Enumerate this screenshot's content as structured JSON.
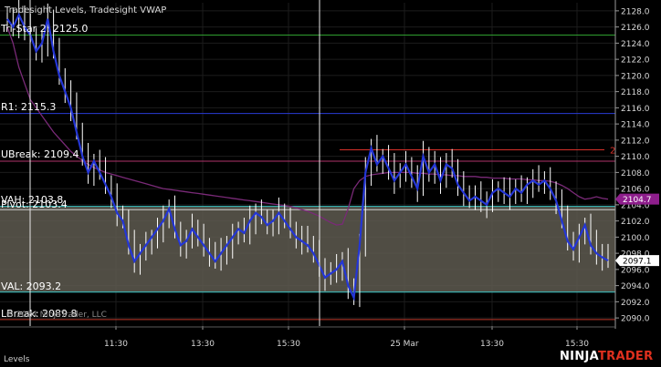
{
  "chart_data": {
    "type": "candlestick",
    "title": "Tradesight Levels, Tradesight VWAP",
    "panel_label": "Levels",
    "copyright": "© 2024 NinjaTrader, LLC",
    "ylim": [
      2089.0,
      2129.0
    ],
    "y_ticks": [
      2090.0,
      2092.0,
      2094.0,
      2096.0,
      2098.0,
      2100.0,
      2102.0,
      2104.0,
      2106.0,
      2108.0,
      2110.0,
      2112.0,
      2114.0,
      2116.0,
      2118.0,
      2120.0,
      2122.0,
      2124.0,
      2126.0,
      2128.0
    ],
    "y_tick_labels": [
      "2090.0",
      "2092.0",
      "2094.0",
      "2096.0",
      "2098.0",
      "2100.0",
      "2102.0",
      "2104.0",
      "2106.0",
      "2108.0",
      "2110.0",
      "2112.0",
      "2114.0",
      "2116.0",
      "2118.0",
      "2120.0",
      "2122.0",
      "2124.0",
      "2126.0",
      "2128.0"
    ],
    "x_tick_labels": [
      "11:30",
      "13:30",
      "15:30",
      "25 Mar",
      "13:30",
      "15:30"
    ],
    "grid": true,
    "value_area": {
      "low": 2093.2,
      "high": 2103.8,
      "color": "#5e5a50"
    },
    "levels": [
      {
        "label": "Tri-Star 2: 2125.0",
        "value": 2125.0,
        "color": "#2f9e2f"
      },
      {
        "label": "R1: 2115.3",
        "value": 2115.3,
        "color": "#2a3bd6"
      },
      {
        "label": "UBreak: 2109.4",
        "value": 2109.4,
        "color": "#b0336a"
      },
      {
        "label": "VAH: 2103.8",
        "value": 2103.8,
        "color": "#39c6c6"
      },
      {
        "label": "Pivot: 2103.4",
        "value": 2103.4,
        "color": "#cfcfcf"
      },
      {
        "label": "VAL: 2093.2",
        "value": 2093.2,
        "color": "#39c6c6"
      },
      {
        "label": "LBreak: 2089.8",
        "value": 2089.8,
        "color": "#c0392b"
      }
    ],
    "short_level": {
      "label": "2",
      "value": 2110.8,
      "color": "#d6312a"
    },
    "markers": [
      {
        "label": "2104.7",
        "value": 2104.7,
        "color": "#8e1e8c"
      },
      {
        "label": "2097.1",
        "value": 2097.1,
        "color": "#ffffff"
      }
    ],
    "vwap_color": "#7a2a78",
    "vwap": [
      2126,
      2124,
      2121,
      2119,
      2117,
      2116,
      2115,
      2114,
      2113,
      2112.2,
      2111.4,
      2110.6,
      2110.0,
      2109.5,
      2109.0,
      2108.6,
      2108.3,
      2108.0,
      2107.8,
      2107.6,
      2107.4,
      2107.2,
      2107.0,
      2106.8,
      2106.6,
      2106.4,
      2106.2,
      2106.0,
      2105.9,
      2105.8,
      2105.7,
      2105.6,
      2105.5,
      2105.4,
      2105.3,
      2105.2,
      2105.1,
      2105.0,
      2104.9,
      2104.8,
      2104.7,
      2104.6,
      2104.5,
      2104.4,
      2104.3,
      2104.2,
      2104.1,
      2104.0,
      2103.9,
      2103.8,
      2103.6,
      2103.4,
      2103.2,
      2102.9,
      2102.6,
      2102.2,
      2101.8,
      2101.5,
      2101.6,
      2103.5,
      2106.0,
      2107.0,
      2107.5,
      2107.7,
      2107.8,
      2107.9,
      2108.0,
      2108.0,
      2108.0,
      2108.0,
      2108.0,
      2107.9,
      2107.9,
      2107.8,
      2107.8,
      2107.7,
      2107.7,
      2107.6,
      2107.6,
      2107.5,
      2107.5,
      2107.5,
      2107.4,
      2107.4,
      2107.3,
      2107.3,
      2107.3,
      2107.2,
      2107.2,
      2107.2,
      2107.1,
      2107.1,
      2107.0,
      2107.0,
      2106.9,
      2106.7,
      2106.4,
      2106.0,
      2105.5,
      2105.0,
      2104.7,
      2104.8,
      2105.0,
      2104.8,
      2104.7
    ],
    "closes": [
      2127,
      2126,
      2127.5,
      2126,
      2125,
      2123,
      2124,
      2127,
      2123,
      2120,
      2118,
      2116,
      2113,
      2110,
      2108,
      2109.4,
      2108,
      2106.5,
      2105,
      2103,
      2102,
      2099,
      2097,
      2098,
      2099,
      2100,
      2101,
      2102,
      2103.5,
      2101,
      2099,
      2099.5,
      2101,
      2100,
      2099,
      2098,
      2097,
      2098,
      2099,
      2100,
      2101,
      2100.5,
      2102,
      2103,
      2102.5,
      2101.5,
      2102,
      2103,
      2102,
      2101,
      2100,
      2099.5,
      2099,
      2098,
      2096.5,
      2095,
      2095.5,
      2096,
      2097,
      2094,
      2092.5,
      2099,
      2108,
      2111,
      2109,
      2110,
      2108.5,
      2107,
      2108,
      2109,
      2107.5,
      2106,
      2110,
      2108,
      2109,
      2107,
      2109,
      2108.5,
      2106.5,
      2105.5,
      2104.5,
      2105,
      2104.5,
      2104,
      2105.5,
      2106,
      2105.5,
      2105,
      2106,
      2105.5,
      2106.5,
      2107,
      2106.5,
      2107,
      2106,
      2104.5,
      2102,
      2099.5,
      2098.5,
      2100,
      2101.5,
      2099,
      2098,
      2097.5,
      2097.1
    ]
  }
}
